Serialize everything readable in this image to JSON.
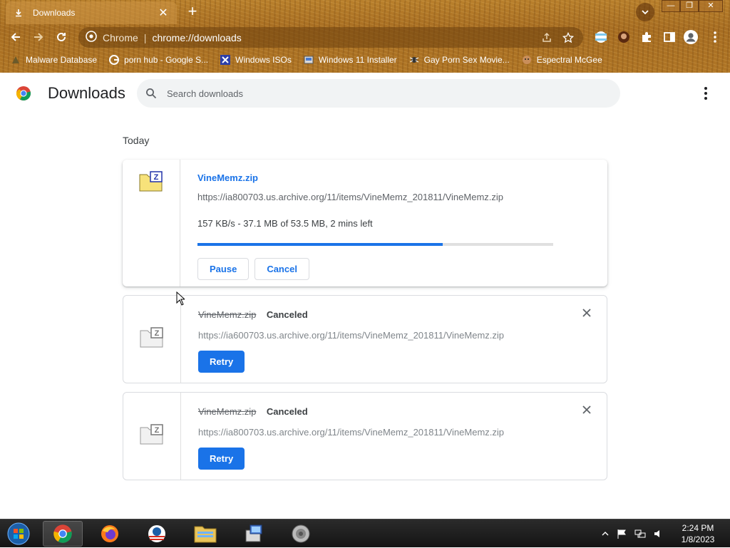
{
  "window": {
    "tab_title": "Downloads",
    "tab_close": "✕",
    "new_tab": "+",
    "controls": {
      "minimize": "—",
      "maximize": "❐",
      "close": "✕"
    }
  },
  "toolbar": {
    "site_label": "Chrome",
    "url": "chrome://downloads"
  },
  "bookmarks": [
    {
      "label": "Malware Database",
      "icon": "skull-icon"
    },
    {
      "label": "porn hub - Google S...",
      "icon": "google-icon"
    },
    {
      "label": "Windows ISOs",
      "icon": "x-icon"
    },
    {
      "label": "Windows 11 Installer",
      "icon": "installer-icon"
    },
    {
      "label": "Gay Porn Sex Movie...",
      "icon": "spider-icon"
    },
    {
      "label": "Espectral McGee",
      "icon": "face-icon"
    }
  ],
  "page": {
    "title": "Downloads",
    "search_placeholder": "Search downloads",
    "section_date": "Today"
  },
  "downloads": [
    {
      "filename": "VineMemz.zip",
      "url": "https://ia800703.us.archive.org/11/items/VineMemz_201811/VineMemz.zip",
      "progress_text": "157 KB/s - 37.1 MB of 53.5 MB, 2 mins left",
      "progress_fraction": 0.69,
      "pause_label": "Pause",
      "cancel_label": "Cancel"
    },
    {
      "filename": "VineMemz.zip",
      "status": "Canceled",
      "url": "https://ia600703.us.archive.org/11/items/VineMemz_201811/VineMemz.zip",
      "retry_label": "Retry"
    },
    {
      "filename": "VineMemz.zip",
      "status": "Canceled",
      "url": "https://ia800703.us.archive.org/11/items/VineMemz_201811/VineMemz.zip",
      "retry_label": "Retry"
    }
  ],
  "taskbar": {
    "time": "2:24 PM",
    "date": "1/8/2023"
  },
  "colors": {
    "accent": "#1a73e8",
    "frame": "#b07626"
  }
}
